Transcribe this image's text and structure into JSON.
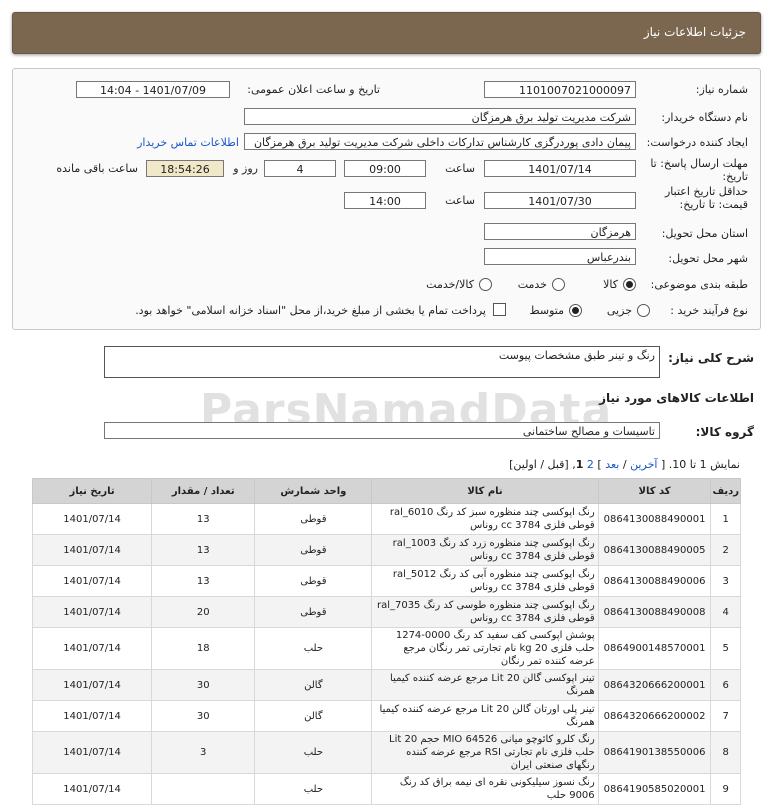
{
  "title": "جزئیات اطلاعات نیاز",
  "fields": {
    "need_number_label": "شماره نیاز:",
    "need_number": "1101007021000097",
    "announce_label": "تاریخ و ساعت اعلان عمومی:",
    "announce_value": "1401/07/09 - 14:04",
    "buyer_label": "نام دستگاه خریدار:",
    "buyer": "شرکت مدیریت تولید برق هرمزگان",
    "creator_label": "ایجاد کننده درخواست:",
    "creator": "پیمان دادی پوردرگزی کارشناس تدارکات داخلی شرکت مدیریت تولید برق هرمزگان",
    "contact_link": "اطلاعات تماس خریدار",
    "deadline_label": "مهلت ارسال پاسخ: تا تاریخ:",
    "deadline_date": "1401/07/14",
    "time_label": "ساعت",
    "deadline_time": "09:00",
    "days_count": "4",
    "days_label": "روز و",
    "remaining_time": "18:54:26",
    "remaining_label": "ساعت باقی مانده",
    "validity_label": "حداقل تاریخ اعتبار قیمت: تا تاریخ:",
    "validity_date": "1401/07/30",
    "validity_time": "14:00",
    "province_label": "استان محل تحویل:",
    "province": "هرمزگان",
    "city_label": "شهر محل تحویل:",
    "city": "بندرعباس",
    "category_label": "طبقه بندی موضوعی:",
    "category_options": [
      "کالا",
      "خدمت",
      "کالا/خدمت"
    ],
    "category_selected": "کالا",
    "process_label": "نوع فرآیند خرید :",
    "process_options": [
      "جزیی",
      "متوسط"
    ],
    "process_selected": "متوسط",
    "payment_note": "پرداخت تمام یا بخشی از مبلغ خرید،از محل \"اسناد خزانه اسلامی\" خواهد بود."
  },
  "summary_label": "شرح کلی نیاز:",
  "summary": "رنگ و تینر طبق مشخصات پیوست",
  "goods_info_title": "اطلاعات کالاهای مورد نیاز",
  "group_label": "گروه کالا:",
  "group_value": "تاسیسات و مصالح ساختمانی",
  "paging": {
    "showing": "نمایش 1 تا 10.",
    "last": "آخرین",
    "next": "بعد",
    "page2": "2",
    "page1": "1",
    "prev_first": "[قبل / اولین]"
  },
  "watermark": "ParsNamadData",
  "table": {
    "headers": [
      "ردیف",
      "کد کالا",
      "نام کالا",
      "واحد شمارش",
      "تعداد / مقدار",
      "تاریخ نیاز"
    ],
    "rows": [
      [
        "1",
        "0864130088490001",
        "رنگ اپوکسی چند منظوره سبز کد رنگ ral_6010 قوطی فلزی 3784 cc روناس",
        "قوطی",
        "13",
        "1401/07/14"
      ],
      [
        "2",
        "0864130088490005",
        "رنگ اپوکسی چند منظوره زرد کد رنگ ral_1003 قوطی فلزی 3784 cc روناس",
        "قوطی",
        "13",
        "1401/07/14"
      ],
      [
        "3",
        "0864130088490006",
        "رنگ اپوکسی چند منظوره آبی کد رنگ ral_5012 قوطی فلزی 3784 cc روناس",
        "قوطی",
        "13",
        "1401/07/14"
      ],
      [
        "4",
        "0864130088490008",
        "رنگ اپوکسی چند منظوره طوسی کد رنگ ral_7035 قوطی فلزی 3784 cc روناس",
        "قوطی",
        "20",
        "1401/07/14"
      ],
      [
        "5",
        "0864900148570001",
        "پوشش اپوکسی کف سفید کد رنگ 0000-1274 حلب فلزی 20 kg نام تجارتی تمر رنگان مرجع عرضه کننده تمر رنگان",
        "حلب",
        "18",
        "1401/07/14"
      ],
      [
        "6",
        "0864320666200001",
        "تینر اپوکسی گالن 20 Lit مرجع عرضه کننده کیمیا همرنگ",
        "گالن",
        "30",
        "1401/07/14"
      ],
      [
        "7",
        "0864320666200002",
        "تینر پلی اورتان گالن 20 Lit مرجع عرضه کننده کیمیا همرنگ",
        "گالن",
        "30",
        "1401/07/14"
      ],
      [
        "8",
        "0864190138550006",
        "رنگ کلرو کائوچو میانی MIO 64526 حجم 20 Lit حلب فلزی نام تجارتی RSI مرجع عرضه کننده رنگهای صنعتی ایران",
        "حلب",
        "3",
        "1401/07/14"
      ],
      [
        "9",
        "0864190585020001",
        "رنگ نسوز سیلیکونی نقره ای نیمه براق کد رنگ 9006 حلب",
        "حلب",
        "",
        "1401/07/14"
      ]
    ]
  }
}
